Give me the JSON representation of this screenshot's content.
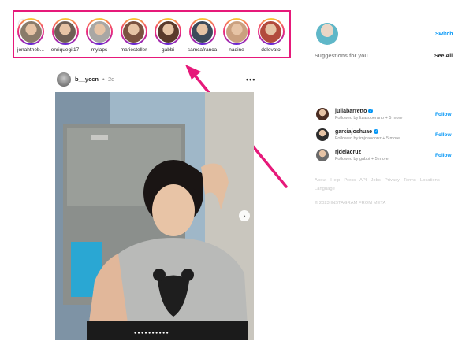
{
  "stories": [
    {
      "username": "jonahtheb...",
      "color": "#8a7b6a"
    },
    {
      "username": "enriquegil17",
      "color": "#6e5f55"
    },
    {
      "username": "myiaps",
      "color": "#a9a7a4"
    },
    {
      "username": "mariesteller",
      "color": "#7a5240"
    },
    {
      "username": "gabbi",
      "color": "#5a3a2c"
    },
    {
      "username": "samcafranca",
      "color": "#3d4a5a"
    },
    {
      "username": "nadine",
      "color": "#caa07f"
    },
    {
      "username": "ddlovato",
      "color": "#b24a3c"
    }
  ],
  "stories_prev_icon": "‹",
  "post": {
    "username": "b__yccn",
    "dot": "•",
    "time": "2d",
    "more": "•••",
    "next_icon": "›",
    "carousel_dots": "●●●●●●●●●●"
  },
  "sidebar": {
    "switch_label": "Switch",
    "suggestions_title": "Suggestions for you",
    "see_all": "See All",
    "suggestions": [
      {
        "name": "juliabarretto",
        "verified": true,
        "sub": "Followed by lizasoberano + 5 more",
        "follow": "Follow",
        "color": "#4a2c22"
      },
      {
        "name": "garciajoshuae",
        "verified": true,
        "sub": "Followed by imjoaoconz + 5 more",
        "follow": "Follow",
        "color": "#2c2c2c"
      },
      {
        "name": "rjdelacruz",
        "verified": false,
        "sub": "Followed by gabbi + 5 more",
        "follow": "Follow",
        "color": "#6a6a6a"
      }
    ],
    "footer_links": "About · Help · Press · API · Jobs · Privacy · Terms · Locations · Language",
    "copyright": "© 2023 INSTAGRAM FROM META"
  },
  "colors": {
    "highlight": "#e6197a",
    "link": "#0095f6"
  }
}
